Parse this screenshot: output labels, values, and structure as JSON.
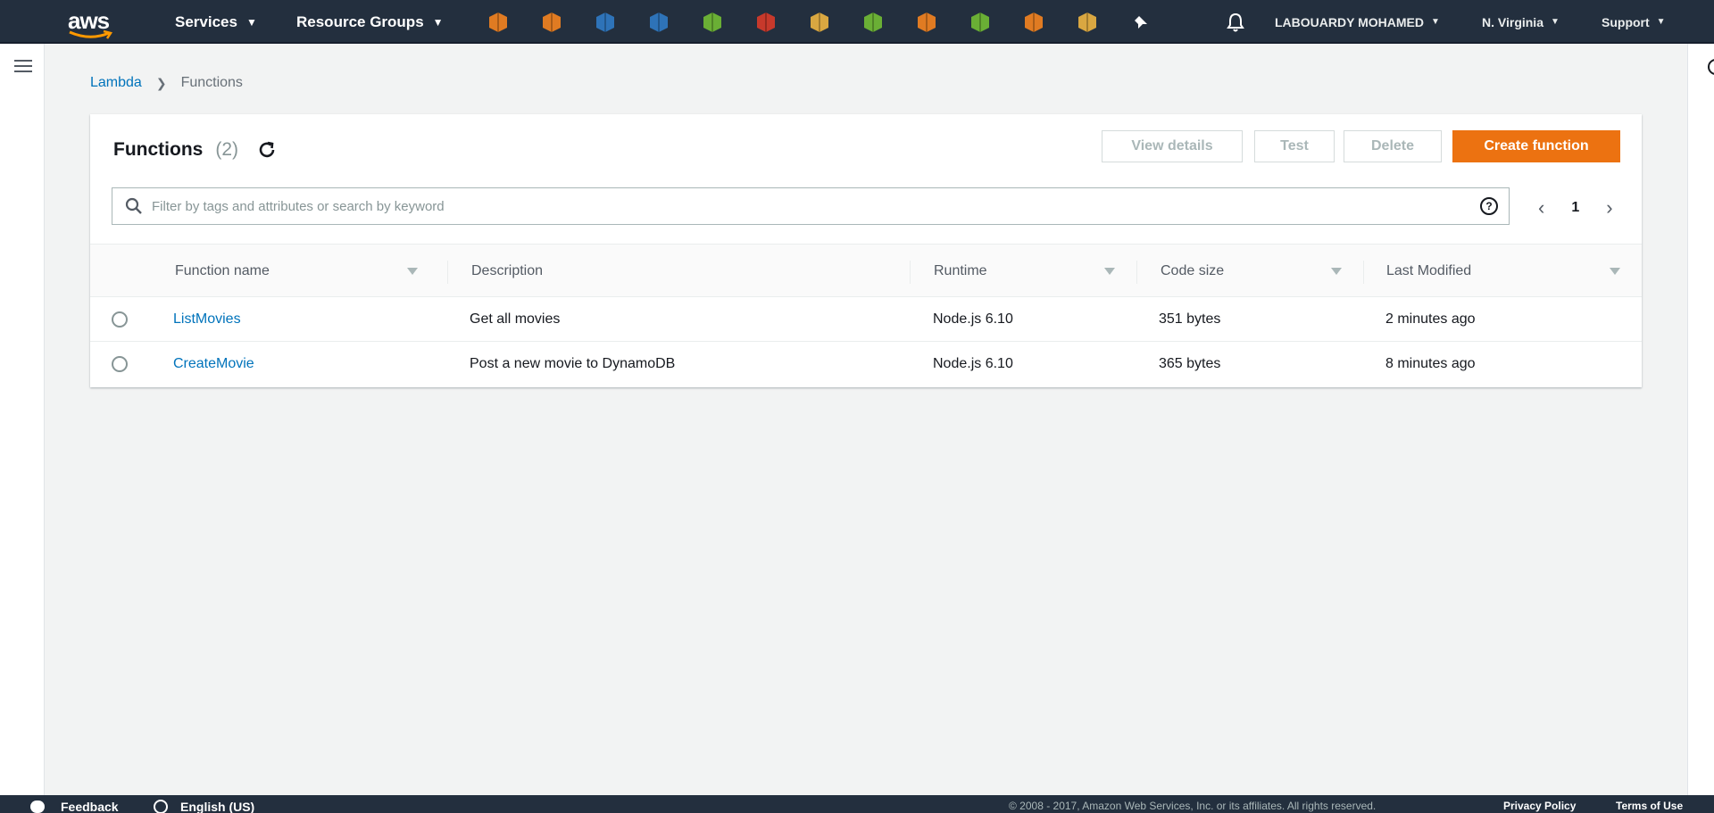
{
  "topnav": {
    "services_label": "Services",
    "resource_groups_label": "Resource Groups",
    "service_icons": [
      {
        "name": "ec2-icon",
        "color": "#e07b22"
      },
      {
        "name": "lambda-icon",
        "color": "#e07b22"
      },
      {
        "name": "s3-icon",
        "color": "#2e73b8"
      },
      {
        "name": "dynamodb-icon",
        "color": "#2e73b8"
      },
      {
        "name": "cloudwatch-icon",
        "color": "#6aaf35"
      },
      {
        "name": "api-gateway-icon",
        "color": "#c7392b"
      },
      {
        "name": "sqs-icon",
        "color": "#d9a741"
      },
      {
        "name": "iam-icon",
        "color": "#6aaf35"
      },
      {
        "name": "cloudfront-icon",
        "color": "#e07b22"
      },
      {
        "name": "elastic-beanstalk-icon",
        "color": "#6aaf35"
      },
      {
        "name": "ecs-icon",
        "color": "#e07b22"
      },
      {
        "name": "sns-icon",
        "color": "#d9a741"
      },
      {
        "name": "pin-icon",
        "color": "#ffffff"
      }
    ],
    "user_label": "LABOUARDY MOHAMED",
    "region_label": "N. Virginia",
    "support_label": "Support"
  },
  "breadcrumb": {
    "root": "Lambda",
    "current": "Functions"
  },
  "panel": {
    "title": "Functions",
    "count": "(2)",
    "view_details_label": "View details",
    "test_label": "Test",
    "delete_label": "Delete",
    "create_label": "Create function",
    "search_placeholder": "Filter by tags and attributes or search by keyword",
    "page_number": "1"
  },
  "table": {
    "headers": {
      "name": "Function name",
      "description": "Description",
      "runtime": "Runtime",
      "code_size": "Code size",
      "last_modified": "Last Modified"
    },
    "rows": [
      {
        "name": "ListMovies",
        "description": "Get all movies",
        "runtime": "Node.js 6.10",
        "code_size": "351 bytes",
        "last_modified": "2 minutes ago"
      },
      {
        "name": "CreateMovie",
        "description": "Post a new movie to DynamoDB",
        "runtime": "Node.js 6.10",
        "code_size": "365 bytes",
        "last_modified": "8 minutes ago"
      }
    ]
  },
  "footer": {
    "feedback_label": "Feedback",
    "language_label": "English (US)",
    "copyright": "© 2008 - 2017, Amazon Web Services, Inc. or its affiliates. All rights reserved.",
    "privacy_label": "Privacy Policy",
    "terms_label": "Terms of Use"
  },
  "colors": {
    "nav_bg": "#232f3e",
    "accent_orange": "#ec7211",
    "link_blue": "#0073bb"
  }
}
